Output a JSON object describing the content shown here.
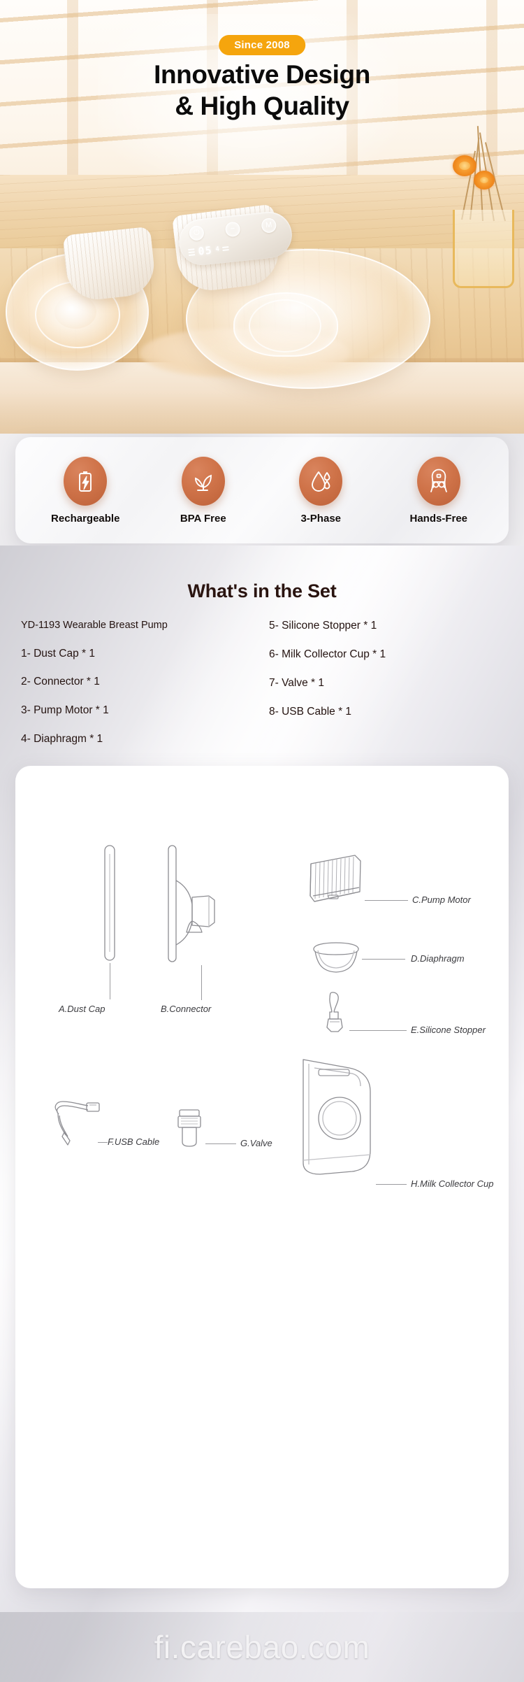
{
  "hero": {
    "badge": "Since 2008",
    "title_line1": "Innovative Design",
    "title_line2": "& High Quality",
    "badge_color": "#f5a50d",
    "device": {
      "power_icon": "power-icon",
      "minus_icon": "minus-icon",
      "mode_icon": "mode-icon",
      "display_value": "05",
      "display_unit": "4",
      "battery_icon": "battery-icon"
    }
  },
  "features": {
    "items": [
      {
        "label": "Rechargeable",
        "icon": "battery-bolt-icon"
      },
      {
        "label": "BPA Free",
        "icon": "leaf-sprout-icon"
      },
      {
        "label": "3-Phase",
        "icon": "water-drops-icon"
      },
      {
        "label": "Hands-Free",
        "icon": "nursing-mother-icon"
      }
    ],
    "icon_color": "#c96f45"
  },
  "set": {
    "title": "What's in the Set",
    "left_column": [
      "YD-1193 Wearable Breast Pump",
      "1- Dust Cap * 1",
      "2- Connector * 1",
      "3- Pump Motor * 1",
      "4- Diaphragm * 1"
    ],
    "right_column": [
      "5- Silicone Stopper * 1",
      "6- Milk Collector Cup * 1",
      "7- Valve * 1",
      "8- USB Cable * 1"
    ]
  },
  "diagram": {
    "labels": [
      {
        "id": "dust-cap",
        "text": "A.Dust Cap"
      },
      {
        "id": "connector",
        "text": "B.Connector"
      },
      {
        "id": "pump-motor",
        "text": "C.Pump Motor"
      },
      {
        "id": "diaphragm",
        "text": "D.Diaphragm"
      },
      {
        "id": "silicone-stopper",
        "text": "E.Silicone Stopper"
      },
      {
        "id": "usb-cable",
        "text": "F.USB Cable"
      },
      {
        "id": "valve",
        "text": "G.Valve"
      },
      {
        "id": "milk-collector-cup",
        "text": "H.Milk Collector Cup"
      }
    ]
  },
  "watermark": {
    "text": "fi.carebao.com"
  }
}
